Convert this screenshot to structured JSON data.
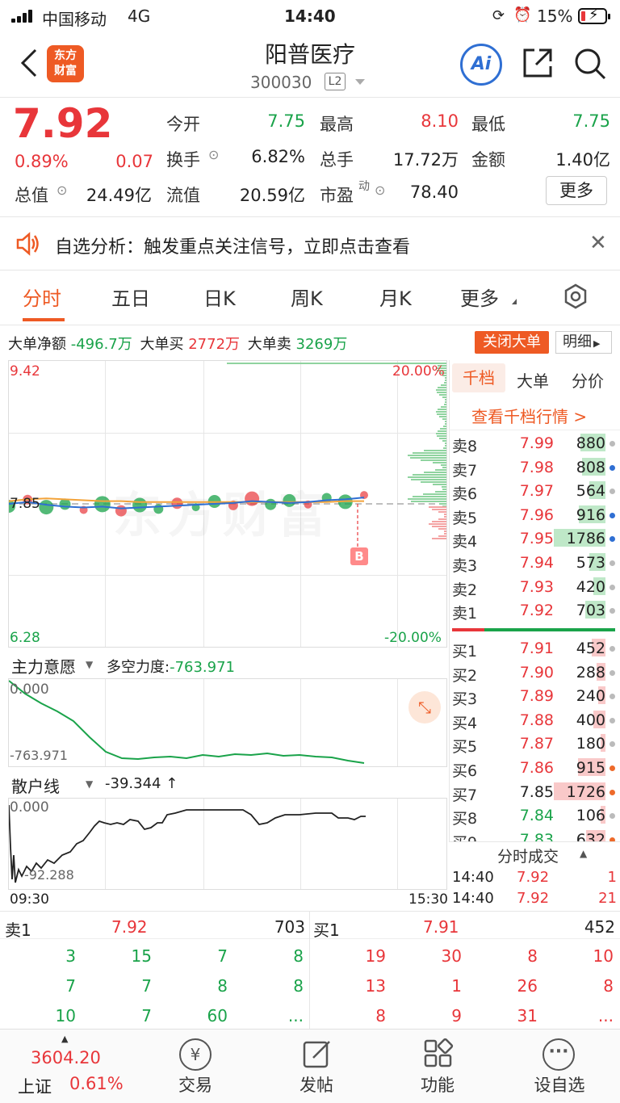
{
  "status_bar": {
    "carrier": "中国移动",
    "network": "4G",
    "time": "14:40",
    "battery": "15%"
  },
  "header": {
    "logo_line1": "东方",
    "logo_line2": "财富",
    "title": "阳普医疗",
    "code": "300030",
    "level": "L2",
    "ai_label": "Ai"
  },
  "quote": {
    "price": "7.92",
    "change_pct": "0.89%",
    "change": "0.07",
    "open_label": "今开",
    "open": "7.75",
    "high_label": "最高",
    "high": "8.10",
    "low_label": "最低",
    "low": "7.75",
    "turnover_label": "换手",
    "turnover": "6.82%",
    "volume_label": "总手",
    "volume": "17.72万",
    "amount_label": "金额",
    "amount": "1.40亿",
    "total_cap_label": "总值",
    "total_cap": "24.49亿",
    "float_cap_label": "流值",
    "float_cap": "20.59亿",
    "pe_label": "市盈",
    "pe_sup": "动",
    "pe": "78.40",
    "more_label": "更多"
  },
  "notice": {
    "text": "自选分析：触发重点关注信号，立即点击查看"
  },
  "tabs": [
    "分时",
    "五日",
    "日K",
    "周K",
    "月K",
    "更多"
  ],
  "bigorder": {
    "net_label": "大单净额",
    "net": "-496.7万",
    "buy_label": "大单买",
    "buy": "2772万",
    "sell_label": "大单卖",
    "sell": "3269万",
    "close_btn": "关闭大单",
    "detail_btn": "明细"
  },
  "chart": {
    "y_max": "9.42",
    "y_min": "6.28",
    "pct_max": "20.00%",
    "pct_min": "-20.00%",
    "prev_close": "7.85",
    "marker": "B",
    "time_start": "09:30",
    "time_end": "15:30",
    "watermark": "东方财富"
  },
  "chart_data": {
    "type": "line",
    "title": "",
    "ylim": [
      6.28,
      9.42
    ],
    "reference": 7.85,
    "series": [
      {
        "values": [
          7.85,
          7.87,
          7.84,
          7.82,
          7.81,
          7.82,
          7.8,
          7.81,
          7.82,
          7.83,
          7.84,
          7.85,
          7.86,
          7.88,
          7.87,
          7.86,
          7.87,
          7.89,
          7.9,
          7.92
        ]
      },
      {
        "values": [
          7.88,
          7.9,
          7.91,
          7.9,
          7.89,
          7.88,
          7.88,
          7.87,
          7.87,
          7.87,
          7.87,
          7.87,
          7.87,
          7.87,
          7.87,
          7.87,
          7.87,
          7.87,
          7.88,
          7.88
        ]
      }
    ]
  },
  "indicator1": {
    "name": "主力意愿",
    "param_label": "多空力度:",
    "param_value": "-763.971",
    "top": "0.000",
    "bottom": "-763.971"
  },
  "indicator2": {
    "name": "散户线",
    "value": "-39.344 ↑",
    "top": "0.000",
    "bottom": "-92.288"
  },
  "orderbook": {
    "tabs": [
      "千档",
      "大单",
      "分价"
    ],
    "link": "查看千档行情 >",
    "sells": [
      {
        "label": "卖8",
        "price": "7.99",
        "vol": "880",
        "ratio": 0.49,
        "dot": "#bbb"
      },
      {
        "label": "卖7",
        "price": "7.98",
        "vol": "808",
        "ratio": 0.45,
        "dot": "#2f6fd3"
      },
      {
        "label": "卖6",
        "price": "7.97",
        "vol": "564",
        "ratio": 0.32,
        "dot": "#bbb"
      },
      {
        "label": "卖5",
        "price": "7.96",
        "vol": "916",
        "ratio": 0.51,
        "dot": "#2f6fd3"
      },
      {
        "label": "卖4",
        "price": "7.95",
        "vol": "1786",
        "ratio": 1.0,
        "dot": "#2f6fd3"
      },
      {
        "label": "卖3",
        "price": "7.94",
        "vol": "573",
        "ratio": 0.32,
        "dot": "#bbb"
      },
      {
        "label": "卖2",
        "price": "7.93",
        "vol": "420",
        "ratio": 0.24,
        "dot": "#bbb"
      },
      {
        "label": "卖1",
        "price": "7.92",
        "vol": "703",
        "ratio": 0.39,
        "dot": "#bbb"
      }
    ],
    "buys": [
      {
        "label": "买1",
        "price": "7.91",
        "vol": "452",
        "ratio": 0.26,
        "dot": "#bbb"
      },
      {
        "label": "买2",
        "price": "7.90",
        "vol": "288",
        "ratio": 0.17,
        "dot": "#bbb"
      },
      {
        "label": "买3",
        "price": "7.89",
        "vol": "240",
        "ratio": 0.14,
        "dot": "#bbb"
      },
      {
        "label": "买4",
        "price": "7.88",
        "vol": "400",
        "ratio": 0.23,
        "dot": "#bbb"
      },
      {
        "label": "买5",
        "price": "7.87",
        "vol": "180",
        "ratio": 0.1,
        "dot": "#bbb"
      },
      {
        "label": "买6",
        "price": "7.86",
        "vol": "915",
        "ratio": 0.53,
        "dot": "#ee6a2a"
      },
      {
        "label": "买7",
        "price": "7.85",
        "vol": "1726",
        "ratio": 1.0,
        "dot": "#ee6a2a"
      },
      {
        "label": "买8",
        "price": "7.84",
        "vol": "106",
        "ratio": 0.06,
        "dot": "#bbb"
      },
      {
        "label": "买9",
        "price": "7.83",
        "vol": "632",
        "ratio": 0.37,
        "dot": "#ee6a2a"
      }
    ],
    "trades_title": "分时成交",
    "trades": [
      {
        "time": "14:40",
        "price": "7.92",
        "vol": "1"
      },
      {
        "time": "14:40",
        "price": "7.92",
        "vol": "21"
      }
    ]
  },
  "depth": {
    "sell_label": "卖1",
    "sell_price": "7.92",
    "sell_vol": "703",
    "buy_label": "买1",
    "buy_price": "7.91",
    "buy_vol": "452",
    "sell_queue": [
      [
        "3",
        "15",
        "7",
        "8"
      ],
      [
        "7",
        "7",
        "8",
        "8"
      ],
      [
        "10",
        "7",
        "60",
        "..."
      ]
    ],
    "buy_queue": [
      [
        "19",
        "30",
        "8",
        "10"
      ],
      [
        "13",
        "1",
        "26",
        "8"
      ],
      [
        "8",
        "9",
        "31",
        "..."
      ]
    ]
  },
  "bottom": {
    "index_value": "3604.20",
    "index_name": "上证",
    "index_pct": "0.61%",
    "nav": [
      "交易",
      "发帖",
      "功能",
      "设自选"
    ]
  }
}
